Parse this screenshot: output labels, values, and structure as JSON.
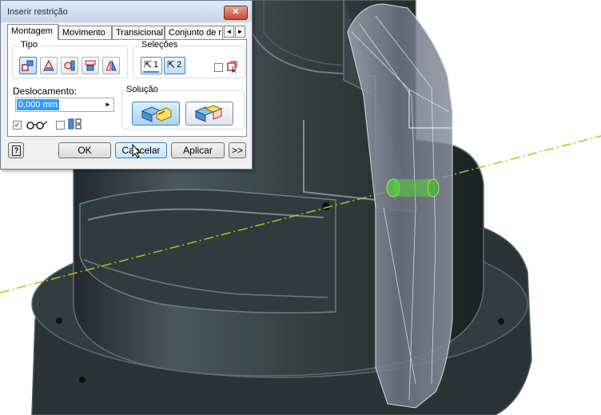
{
  "dialog": {
    "title": "Inserir restrição",
    "close_icon": "close-icon",
    "tabs": [
      {
        "label": "Montagem",
        "active": true
      },
      {
        "label": "Movimento",
        "active": false
      },
      {
        "label": "Transicional",
        "active": false
      },
      {
        "label": "Conjunto de r",
        "active": false
      }
    ],
    "tab_scroll": {
      "left": "◄",
      "right": "►"
    },
    "tipo": {
      "label": "Tipo",
      "buttons": [
        {
          "name": "mate-constraint-icon",
          "selected": true
        },
        {
          "name": "angle-constraint-icon",
          "selected": false
        },
        {
          "name": "tangent-constraint-icon",
          "selected": false
        },
        {
          "name": "insert-constraint-icon",
          "selected": false
        },
        {
          "name": "symmetry-constraint-icon",
          "selected": false
        }
      ]
    },
    "selecoes": {
      "label": "Seleções",
      "select1": "1",
      "select2": "2",
      "pick_part_first_checked": false
    },
    "deslocamento": {
      "label": "Deslocamento:",
      "value": "0,000 mm",
      "spin_icon": "►"
    },
    "options": {
      "show_preview_checked": true,
      "show_preview_icon": "glasses-icon",
      "predict_offset_checked": false,
      "predict_offset_icon": "offset-orientation-icon",
      "check_glyph": "✓"
    },
    "solucao": {
      "label": "Solução",
      "buttons": [
        {
          "name": "mate-solution-icon",
          "selected": true
        },
        {
          "name": "flush-solution-icon",
          "selected": false
        }
      ]
    },
    "footer": {
      "help_glyph": "?",
      "ok": "OK",
      "cancel": "Cancelar",
      "apply": "Aplicar",
      "more": ">>"
    }
  },
  "colors": {
    "part_body": "#2f3a3e",
    "axis_line": "#b5c21a",
    "highlight": "#58d13a",
    "transparent_part": "#8b8f9e"
  }
}
